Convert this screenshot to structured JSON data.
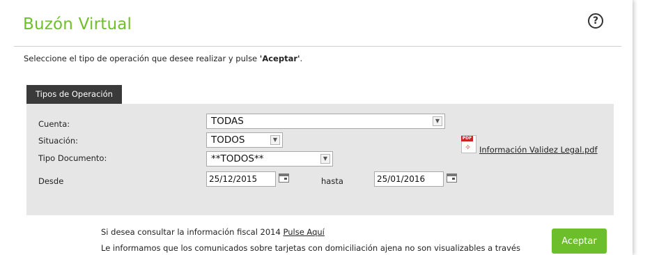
{
  "page": {
    "title": "Buzón Virtual",
    "help_icon_glyph": "?",
    "intro_prefix": "Seleccione el tipo de operación que desee realizar y pulse ",
    "intro_bold": "'Aceptar'",
    "intro_suffix": "."
  },
  "tab": {
    "label": "Tipos de Operación"
  },
  "form": {
    "cuenta": {
      "label": "Cuenta:",
      "value": "TODAS"
    },
    "situacion": {
      "label": "Situación:",
      "value": "TODOS"
    },
    "tipo_documento": {
      "label": "Tipo Documento:",
      "value": "**TODOS**"
    },
    "desde": {
      "label": "Desde",
      "value": "25/12/2015"
    },
    "hasta": {
      "label": "hasta",
      "value": "25/01/2016"
    }
  },
  "pdf": {
    "icon_tag": "PDF",
    "link_text": "Información Validez Legal.pdf"
  },
  "footer": {
    "info_prefix": "Si desea consultar la información fiscal 2014 ",
    "info_link": "Pulse Aquí",
    "notice": "Le informamos que los comunicados sobre tarjetas con domiciliación ajena no son visualizables a través"
  },
  "buttons": {
    "accept": "Aceptar"
  },
  "colors": {
    "accent": "#6cbf2a",
    "title": "#6fbf2b",
    "tab_bg": "#3a3a3a",
    "form_bg": "#e6e6e6"
  }
}
